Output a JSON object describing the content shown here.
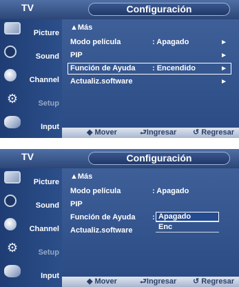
{
  "panel1": {
    "header": {
      "tv": "TV",
      "title": "Configuración"
    },
    "sidebar": [
      {
        "label": "Picture",
        "icon": "picture-icon"
      },
      {
        "label": "Sound",
        "icon": "sound-icon"
      },
      {
        "label": "Channel",
        "icon": "channel-icon"
      },
      {
        "label": "Setup",
        "icon": "setup-icon"
      },
      {
        "label": "Input",
        "icon": "input-icon"
      }
    ],
    "more": "▲Más",
    "rows": [
      {
        "label": "Modo película",
        "value": ": Apagado",
        "arrow": "►"
      },
      {
        "label": "PIP",
        "value": "",
        "arrow": "►"
      },
      {
        "label": "Función de Ayuda",
        "value": ": Encendido",
        "arrow": "►"
      },
      {
        "label": "Actualiz.software",
        "value": "",
        "arrow": "►"
      }
    ],
    "footer": {
      "move": "◆ Mover",
      "enter": "⮐Ingresar",
      "back": "↺ Regresar"
    }
  },
  "panel2": {
    "header": {
      "tv": "TV",
      "title": "Configuración"
    },
    "sidebar": [
      {
        "label": "Picture",
        "icon": "picture-icon"
      },
      {
        "label": "Sound",
        "icon": "sound-icon"
      },
      {
        "label": "Channel",
        "icon": "channel-icon"
      },
      {
        "label": "Setup",
        "icon": "setup-icon"
      },
      {
        "label": "Input",
        "icon": "input-icon"
      }
    ],
    "more": "▲Más",
    "rows": [
      {
        "label": "Modo película",
        "value": ": Apagado"
      },
      {
        "label": "PIP",
        "value": ""
      },
      {
        "label": "Función de Ayuda",
        "value": ":"
      },
      {
        "label": "Actualiz.software",
        "value": ""
      }
    ],
    "dropdown": {
      "options": [
        "Apagado",
        "Enc"
      ],
      "selected": "Apagado"
    },
    "footer": {
      "move": "◆ Mover",
      "enter": "⮐Ingresar",
      "back": "↺ Regresar"
    }
  }
}
